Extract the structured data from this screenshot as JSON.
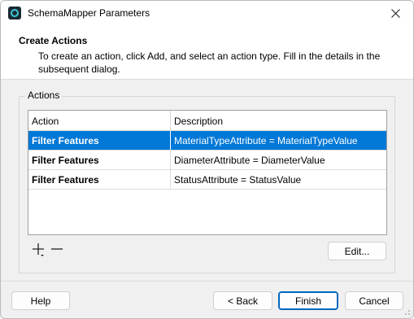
{
  "window": {
    "title": "SchemaMapper Parameters",
    "app_icon": "app-logo-icon",
    "close_icon": "close-icon"
  },
  "header": {
    "title": "Create Actions",
    "description": "To create an action, click Add, and select an action type. Fill in the details in the subsequent dialog."
  },
  "actions_group": {
    "label": "Actions",
    "columns": [
      "Action",
      "Description"
    ],
    "rows": [
      {
        "action": "Filter Features",
        "description": "MaterialTypeAttribute = MaterialTypeValue",
        "selected": true
      },
      {
        "action": "Filter Features",
        "description": "DiameterAttribute = DiameterValue",
        "selected": false
      },
      {
        "action": "Filter Features",
        "description": "StatusAttribute = StatusValue",
        "selected": false
      }
    ],
    "add_icon": "add-dropdown-icon",
    "remove_icon": "remove-icon",
    "edit_label": "Edit..."
  },
  "footer": {
    "help_label": "Help",
    "back_label": "< Back",
    "finish_label": "Finish",
    "cancel_label": "Cancel"
  },
  "colors": {
    "selection": "#0078d7",
    "default_button_border": "#0067c0",
    "dialog_bg": "#f0f0f0"
  }
}
